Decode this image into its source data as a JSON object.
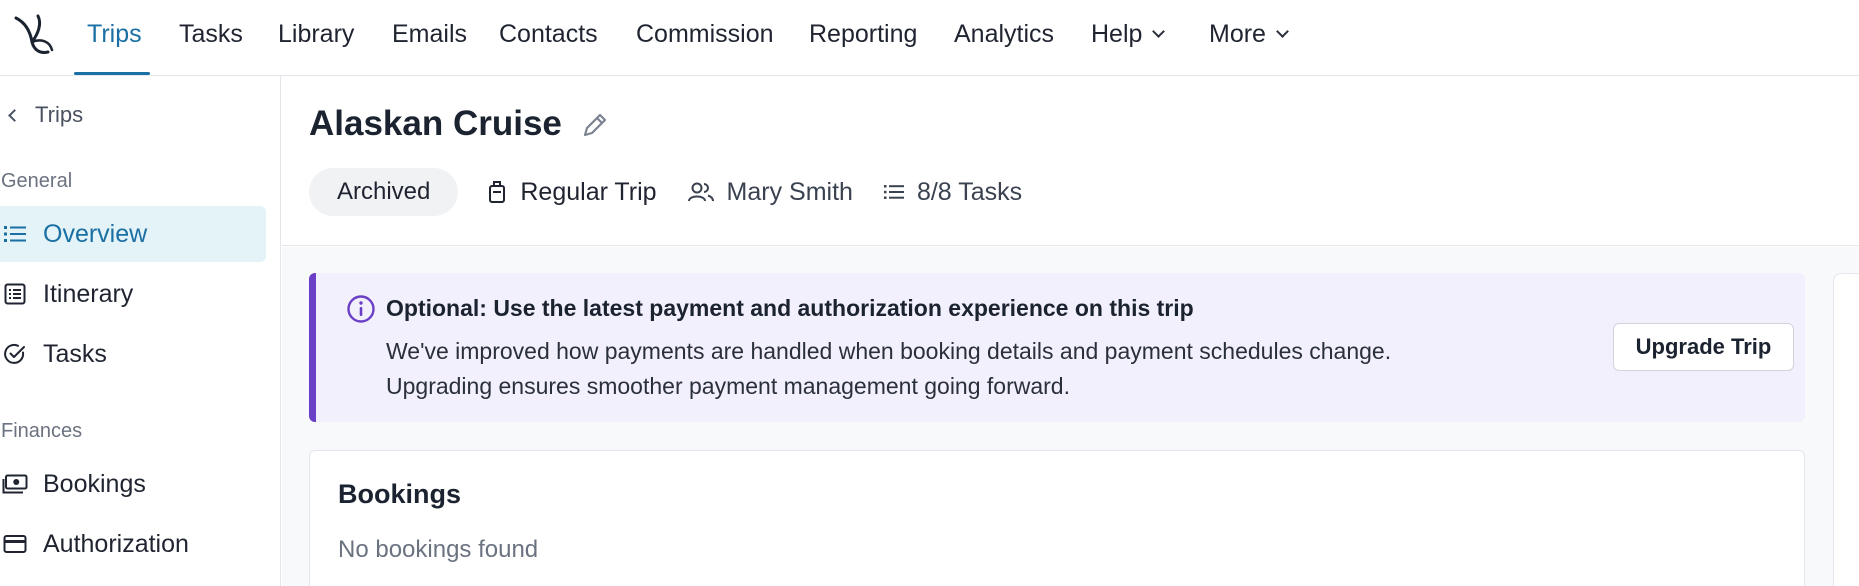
{
  "nav": {
    "items": [
      {
        "label": "Trips"
      },
      {
        "label": "Tasks"
      },
      {
        "label": "Library"
      },
      {
        "label": "Emails"
      },
      {
        "label": "Contacts"
      },
      {
        "label": "Commission"
      },
      {
        "label": "Reporting"
      },
      {
        "label": "Analytics"
      },
      {
        "label": "Help"
      },
      {
        "label": "More"
      }
    ],
    "active": "Trips",
    "accent_color": "#1a6fa3"
  },
  "sidebar": {
    "back_label": "Trips",
    "general_label": "General",
    "general_items": [
      {
        "label": "Overview",
        "icon": "list-icon"
      },
      {
        "label": "Itinerary",
        "icon": "itinerary-icon"
      },
      {
        "label": "Tasks",
        "icon": "check-circle-icon"
      }
    ],
    "finances_label": "Finances",
    "finance_items": [
      {
        "label": "Bookings",
        "icon": "money-icon"
      },
      {
        "label": "Authorization",
        "icon": "credit-card-icon"
      }
    ]
  },
  "trip": {
    "title": "Alaskan Cruise",
    "status": "Archived",
    "trip_type": "Regular Trip",
    "advisor": "Mary Smith",
    "tasks": "8/8 Tasks"
  },
  "banner": {
    "title": "Optional: Use the latest payment and authorization experience on this trip",
    "line1": "We've improved how payments are handled when booking details and payment schedules change.",
    "line2": "Upgrading ensures smoother payment management going forward.",
    "button_label": "Upgrade Trip",
    "accent_color": "#6a3fc6"
  },
  "bookings": {
    "title": "Bookings",
    "empty_text": "No bookings found"
  }
}
